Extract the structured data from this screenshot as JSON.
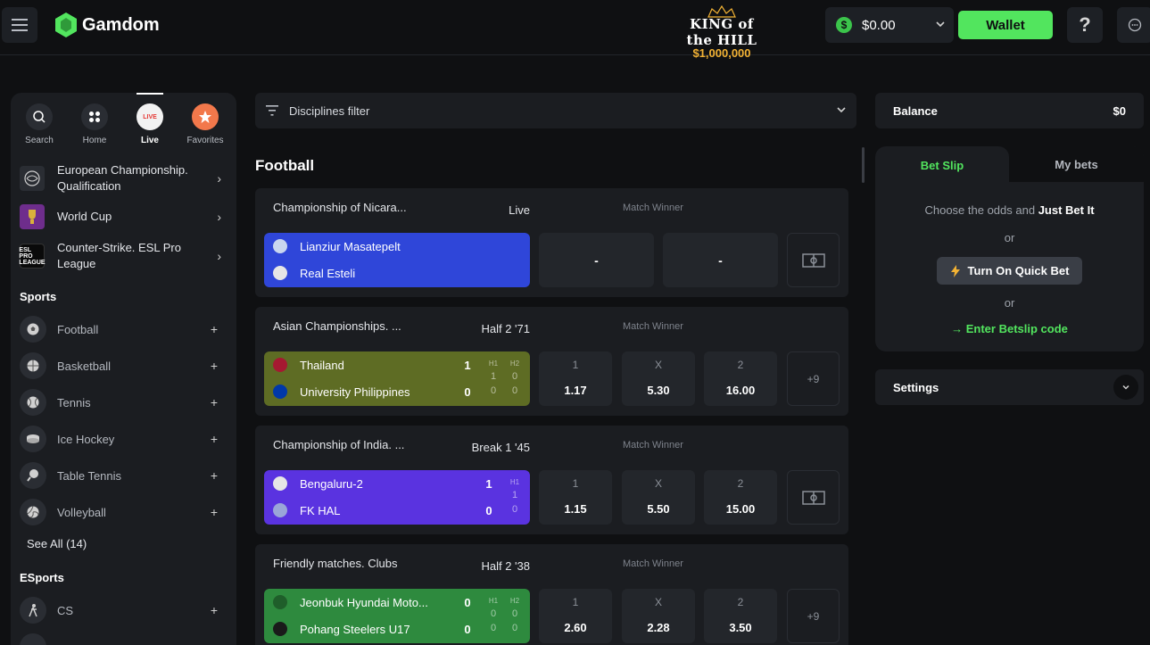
{
  "header": {
    "logo_text": "Gamdom",
    "promo_title": "KING of the HILL",
    "promo_amount": "$1,000,000",
    "balance": "$0.00",
    "wallet_label": "Wallet",
    "help_label": "?"
  },
  "sidebar": {
    "quicknav": [
      {
        "label": "Search"
      },
      {
        "label": "Home"
      },
      {
        "label": "Live",
        "badge": "LIVE"
      },
      {
        "label": "Favorites"
      }
    ],
    "leagues": [
      {
        "name": "European Championship. Qualification"
      },
      {
        "name": "World Cup"
      },
      {
        "name": "Counter-Strike. ESL Pro League",
        "logo_text": "ESL PRO LEAGUE"
      }
    ],
    "sports_title": "Sports",
    "sports": [
      {
        "name": "Football",
        "icon": "football-icon"
      },
      {
        "name": "Basketball",
        "icon": "basketball-icon"
      },
      {
        "name": "Tennis",
        "icon": "tennis-icon"
      },
      {
        "name": "Ice Hockey",
        "icon": "ice-hockey-icon"
      },
      {
        "name": "Table Tennis",
        "icon": "table-tennis-icon"
      },
      {
        "name": "Volleyball",
        "icon": "volleyball-icon"
      }
    ],
    "see_all": "See All (14)",
    "esports_title": "ESports",
    "esports": [
      {
        "name": "CS",
        "icon": "cs-icon"
      }
    ]
  },
  "main": {
    "filter_label": "Disciplines filter",
    "section_title": "Football",
    "matches": [
      {
        "league": "Championship of Nicara...",
        "status": "Live",
        "market": "Match Winner",
        "team1": "Lianziur Masatepelt",
        "team2": "Real Esteli",
        "color": "#2f46d9",
        "odd_1": "-",
        "odd_2": "-"
      },
      {
        "league": "Asian Championships. ...",
        "status": "Half 2 '71",
        "market": "Match Winner",
        "team1": "Thailand",
        "team2": "University Philippines",
        "score1": "1",
        "score2": "0",
        "h1_label": "H1",
        "h2_label": "H2",
        "h1_1": "1",
        "h2_1": "0",
        "h1_2": "0",
        "h2_2": "0",
        "color": "#5e6c24",
        "odds": [
          {
            "label": "1",
            "value": "1.17"
          },
          {
            "label": "X",
            "value": "5.30"
          },
          {
            "label": "2",
            "value": "16.00"
          }
        ],
        "more": "+9"
      },
      {
        "league": "Championship of India. ...",
        "status": "Break 1 '45",
        "market": "Match Winner",
        "team1": "Bengaluru-2",
        "team2": "FK HAL",
        "score1": "1",
        "score2": "0",
        "h1_label": "H1",
        "h1_1": "1",
        "h1_2": "0",
        "color": "#5a33e0",
        "odds": [
          {
            "label": "1",
            "value": "1.15"
          },
          {
            "label": "X",
            "value": "5.50"
          },
          {
            "label": "2",
            "value": "15.00"
          }
        ]
      },
      {
        "league": "Friendly matches. Clubs",
        "status": "Half 2 '38",
        "market": "Match Winner",
        "team1": "Jeonbuk Hyundai Moto...",
        "team2": "Pohang Steelers U17",
        "score1": "0",
        "score2": "0",
        "h1_label": "H1",
        "h2_label": "H2",
        "h1_1": "0",
        "h2_1": "0",
        "h1_2": "0",
        "h2_2": "0",
        "color": "#2e8a3e",
        "odds": [
          {
            "label": "1",
            "value": "2.60"
          },
          {
            "label": "X",
            "value": "2.28"
          },
          {
            "label": "2",
            "value": "3.50"
          }
        ],
        "more": "+9"
      }
    ]
  },
  "right": {
    "balance_label": "Balance",
    "balance_value": "$0",
    "tab_betslip": "Bet Slip",
    "tab_mybets": "My bets",
    "hint_prefix": "Choose the odds and ",
    "hint_bold": "Just Bet It",
    "or1": "or",
    "quickbet_label": "Turn On Quick Bet",
    "or2": "or",
    "betslip_code": "→ Enter Betslip code",
    "settings_label": "Settings"
  },
  "colors": {
    "accent": "#52e55e",
    "background": "#0f1012",
    "panel": "#1b1d21",
    "promo_gold": "#f2b234"
  }
}
